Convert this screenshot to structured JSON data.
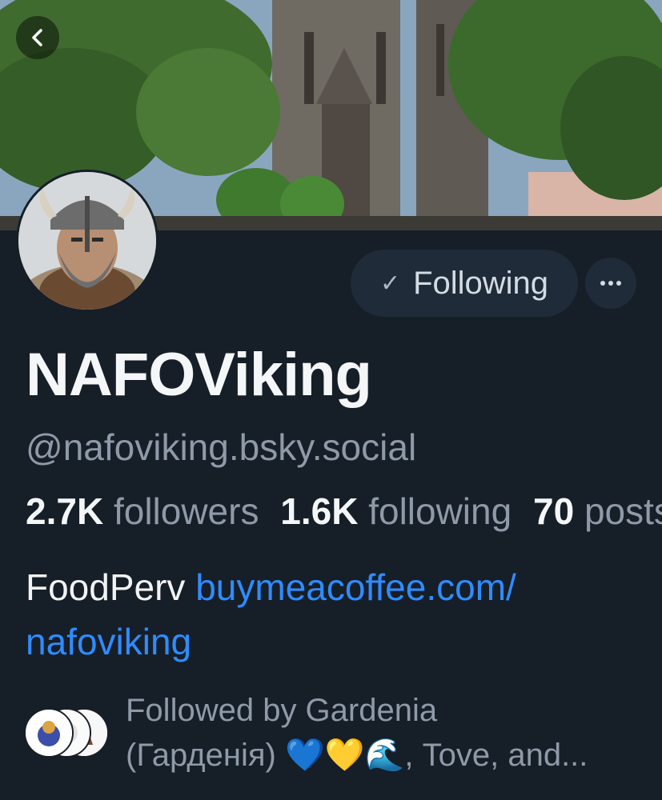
{
  "profile": {
    "display_name": "NAFOViking",
    "handle": "@nafoviking.bsky.social",
    "bio_text": "FoodPerv",
    "bio_link_part1": "buymeacoffee.com/",
    "bio_link_part2": "nafoviking"
  },
  "actions": {
    "following_label": "Following",
    "more_label": "···"
  },
  "stats": {
    "followers_count": "2.7K",
    "followers_label": "followers",
    "following_count": "1.6K",
    "following_label": "following",
    "posts_count": "70",
    "posts_label": "posts"
  },
  "followed_by": {
    "line1": "Followed by Gardenia",
    "line2": "(Гарденія) 💙💛🌊, Tove, and..."
  },
  "colors": {
    "background": "#161e27",
    "link": "#2f8cff",
    "button_bg": "#1f2b38"
  }
}
